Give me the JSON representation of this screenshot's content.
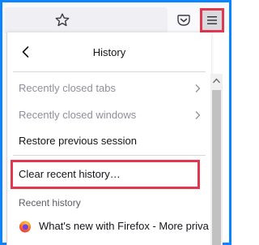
{
  "toolbar": {
    "bookmark_icon": "star-icon",
    "pocket_icon": "pocket-icon",
    "menu_icon": "hamburger-menu-icon"
  },
  "panel": {
    "title": "History",
    "back_icon": "chevron-left-icon",
    "items": [
      {
        "label": "Recently closed tabs",
        "disabled": true,
        "submenu": true
      },
      {
        "label": "Recently closed windows",
        "disabled": true,
        "submenu": true
      },
      {
        "label": "Restore previous session",
        "disabled": false,
        "submenu": false
      },
      {
        "label": "Clear recent history…",
        "disabled": false,
        "submenu": false
      }
    ],
    "recent_label": "Recent history",
    "history_entries": [
      {
        "title": "What's new with Firefox - More privacy, less ...",
        "favicon": "firefox-icon"
      }
    ]
  },
  "colors": {
    "highlight": "#e1384f",
    "frame": "#0a84ff",
    "disabled_text": "#8f8f9d"
  }
}
